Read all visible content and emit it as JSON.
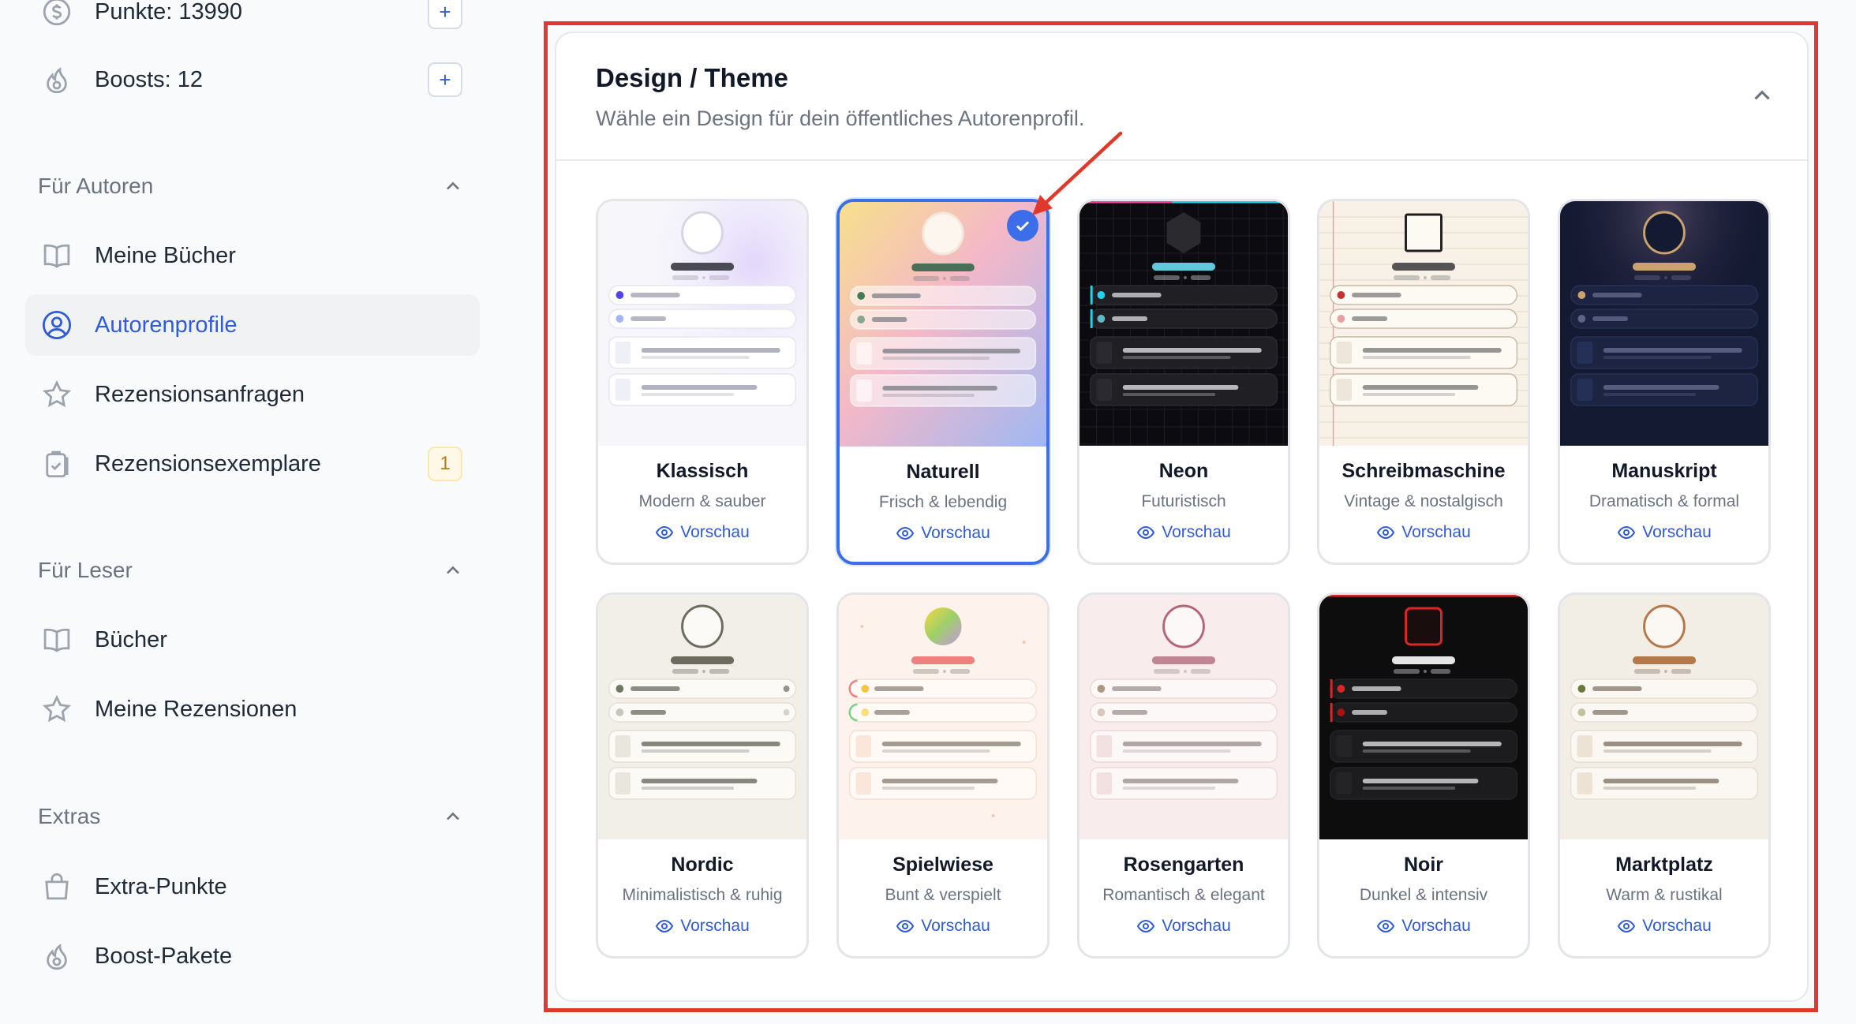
{
  "sidebar": {
    "points_label": "Punkte: 13990",
    "boosts_label": "Boosts: 12",
    "plus_symbol": "+",
    "sections": {
      "authors": {
        "title": "Für Autoren",
        "items": [
          "Meine Bücher",
          "Autorenprofile",
          "Rezensionsanfragen",
          "Rezensionsexemplare"
        ],
        "badge": "1"
      },
      "readers": {
        "title": "Für Leser",
        "items": [
          "Bücher",
          "Meine Rezensionen"
        ]
      },
      "extras": {
        "title": "Extras",
        "items": [
          "Extra-Punkte",
          "Boost-Pakete"
        ]
      }
    },
    "active_item": "Autorenprofile"
  },
  "panel": {
    "title": "Design / Theme",
    "subtitle": "Wähle ein Design für dein öffentliches Autorenprofil.",
    "preview_label": "Vorschau",
    "selected_theme": "Naturell",
    "themes": [
      {
        "name": "Klassisch",
        "desc": "Modern & sauber",
        "accent": "#4f46e5"
      },
      {
        "name": "Naturell",
        "desc": "Frisch & lebendig",
        "accent": "#3f7d5a"
      },
      {
        "name": "Neon",
        "desc": "Futuristisch",
        "accent": "#22d3ee"
      },
      {
        "name": "Schreibmaschine",
        "desc": "Vintage & nostalgisch",
        "accent": "#c53030"
      },
      {
        "name": "Manuskript",
        "desc": "Dramatisch & formal",
        "accent": "#c9a36b"
      },
      {
        "name": "Nordic",
        "desc": "Minimalistisch & ruhig",
        "accent": "#6b6b5e"
      },
      {
        "name": "Spielwiese",
        "desc": "Bunt & verspielt",
        "accent": "#f08080"
      },
      {
        "name": "Rosengarten",
        "desc": "Romantisch & elegant",
        "accent": "#b56576"
      },
      {
        "name": "Noir",
        "desc": "Dunkel & intensiv",
        "accent": "#dc2626"
      },
      {
        "name": "Marktplatz",
        "desc": "Warm & rustikal",
        "accent": "#b5784a"
      }
    ]
  },
  "colors": {
    "brand_blue": "#2f5bd6",
    "highlight_red": "#e0392b"
  }
}
